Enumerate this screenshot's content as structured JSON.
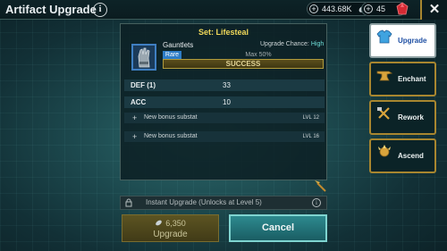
{
  "header": {
    "title": "Artifact Upgrade",
    "silver": "443.68K",
    "gems": "45"
  },
  "panel": {
    "set_label": "Set: Lifesteal",
    "item_name": "Gauntlets",
    "rarity": "Rare",
    "upgrade_chance_label": "Upgrade Chance:",
    "upgrade_chance_value": "High",
    "max_label": "Max 50%",
    "success_label": "SUCCESS",
    "stats": [
      {
        "name": "DEF (1)",
        "value": "33"
      },
      {
        "name": "ACC",
        "value": "10"
      }
    ],
    "substats": [
      {
        "label": "New bonus substat",
        "level": "LVL 12"
      },
      {
        "label": "New bonus substat",
        "level": "LVL 16"
      }
    ]
  },
  "instant": {
    "label": "Instant Upgrade (Unlocks at Level 5)"
  },
  "buttons": {
    "upgrade_cost": "6,350",
    "upgrade_label": "Upgrade",
    "cancel_label": "Cancel"
  },
  "tabs": [
    {
      "label": "Upgrade",
      "icon": "armor-icon",
      "active": true
    },
    {
      "label": "Enchant",
      "icon": "anvil-icon",
      "active": false
    },
    {
      "label": "Rework",
      "icon": "tools-icon",
      "active": false
    },
    {
      "label": "Ascend",
      "icon": "ascend-icon",
      "active": false
    }
  ],
  "colors": {
    "set_title": "#f0d85a",
    "chance_high": "#6fe0d9",
    "rarity_rare": "#2d7cc7",
    "tab_border": "#a8862f",
    "cancel_bg": "#2d8a8f"
  }
}
